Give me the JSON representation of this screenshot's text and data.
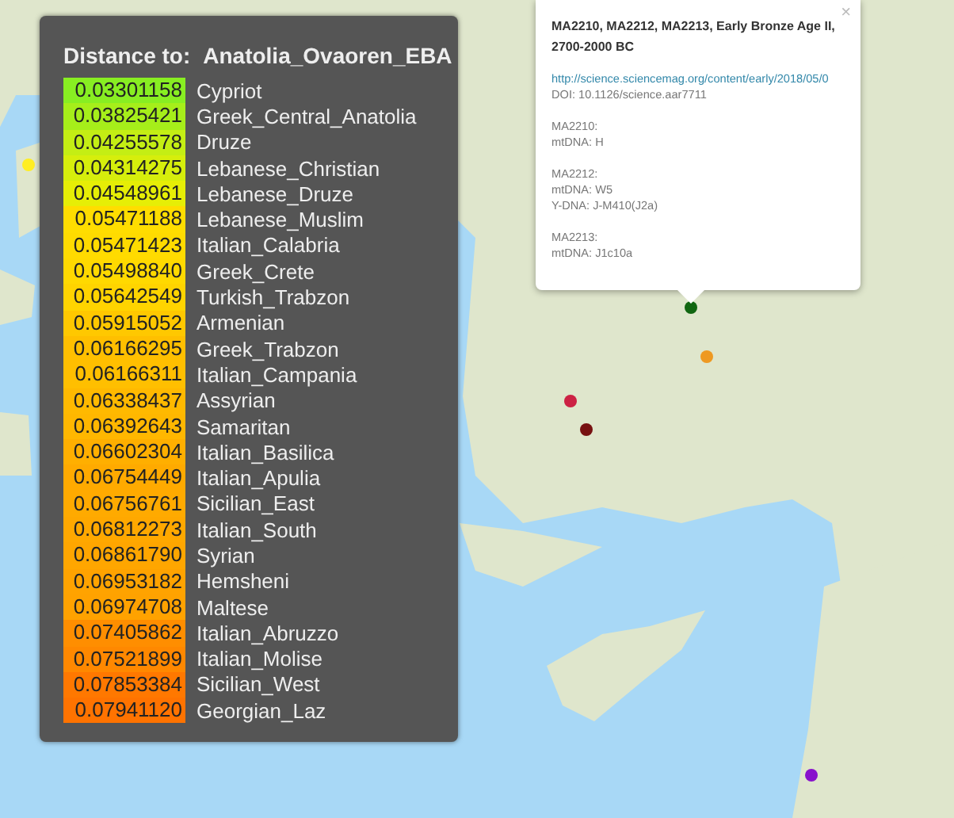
{
  "distance_panel": {
    "heading_label": "Distance to:",
    "heading_target": "Anatolia_Ovaoren_EBA",
    "rows": [
      {
        "value": "0.03301158",
        "name": "Cypriot",
        "color": "#88ee22"
      },
      {
        "value": "0.03825421",
        "name": "Greek_Central_Anatolia",
        "color": "#a6ee1a"
      },
      {
        "value": "0.04255578",
        "name": "Druze",
        "color": "#c4ee14"
      },
      {
        "value": "0.04314275",
        "name": "Lebanese_Christian",
        "color": "#d6ee0c"
      },
      {
        "value": "0.04548961",
        "name": "Lebanese_Druze",
        "color": "#e6ee06"
      },
      {
        "value": "0.05471188",
        "name": "Lebanese_Muslim",
        "color": "#ffdd00"
      },
      {
        "value": "0.05471423",
        "name": "Italian_Calabria",
        "color": "#ffdb00"
      },
      {
        "value": "0.05498840",
        "name": "Greek_Crete",
        "color": "#ffd900"
      },
      {
        "value": "0.05642549",
        "name": "Turkish_Trabzon",
        "color": "#ffd400"
      },
      {
        "value": "0.05915052",
        "name": "Armenian",
        "color": "#ffc800"
      },
      {
        "value": "0.06166295",
        "name": "Greek_Trabzon",
        "color": "#ffbf00"
      },
      {
        "value": "0.06166311",
        "name": "Italian_Campania",
        "color": "#ffbf00"
      },
      {
        "value": "0.06338437",
        "name": "Assyrian",
        "color": "#ffb900"
      },
      {
        "value": "0.06392643",
        "name": "Samaritan",
        "color": "#ffb700"
      },
      {
        "value": "0.06602304",
        "name": "Italian_Basilica",
        "color": "#ffaf00"
      },
      {
        "value": "0.06754449",
        "name": "Italian_Apulia",
        "color": "#ffaa00"
      },
      {
        "value": "0.06756761",
        "name": "Sicilian_East",
        "color": "#ffaa00"
      },
      {
        "value": "0.06812273",
        "name": "Italian_South",
        "color": "#ffa800"
      },
      {
        "value": "0.06861790",
        "name": "Syrian",
        "color": "#ffa600"
      },
      {
        "value": "0.06953182",
        "name": "Hemsheni",
        "color": "#ffa300"
      },
      {
        "value": "0.06974708",
        "name": "Maltese",
        "color": "#ffa200"
      },
      {
        "value": "0.07405862",
        "name": "Italian_Abruzzo",
        "color": "#ff8e00"
      },
      {
        "value": "0.07521899",
        "name": "Italian_Molise",
        "color": "#ff8800"
      },
      {
        "value": "0.07853384",
        "name": "Sicilian_West",
        "color": "#ff7800"
      },
      {
        "value": "0.07941120",
        "name": "Georgian_Laz",
        "color": "#ff7300"
      }
    ]
  },
  "popup": {
    "close": "×",
    "title": "MA2210, MA2212, MA2213, Early Bronze Age II, 2700-2000 BC",
    "link": "http://science.sciencemag.org/content/early/2018/05/0",
    "doi": "DOI: 10.1126/science.aar7711",
    "samples": [
      {
        "lines": [
          "MA2210:",
          "mtDNA: H"
        ]
      },
      {
        "lines": [
          "MA2212:",
          "mtDNA: W5",
          "Y-DNA: J-M410(J2a)"
        ]
      },
      {
        "lines": [
          "MA2213:",
          "mtDNA: J1c10a"
        ]
      }
    ]
  },
  "map": {
    "markers": [
      {
        "color": "#ffee22"
      },
      {
        "color": "#116611"
      },
      {
        "color": "#ee9922"
      },
      {
        "color": "#cc2244"
      },
      {
        "color": "#771111"
      },
      {
        "color": "#8811cc"
      }
    ]
  }
}
